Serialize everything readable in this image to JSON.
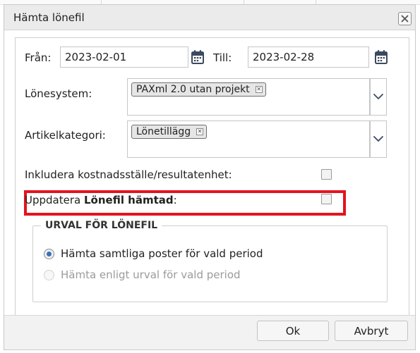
{
  "dialog": {
    "title": "Hämta lönefil",
    "close_icon": "close-icon"
  },
  "dates": {
    "from_label": "Från:",
    "from_value": "2023-02-01",
    "to_label": "Till:",
    "to_value": "2023-02-28",
    "calendar_icon": "calendar-icon"
  },
  "payroll_system": {
    "label": "Lönesystem:",
    "selected_tags": [
      "PAXml 2.0 utan projekt"
    ],
    "dropdown_icon": "chevron-down-icon"
  },
  "article_category": {
    "label": "Artikelkategori:",
    "selected_tags": [
      "Lönetillägg"
    ],
    "dropdown_icon": "chevron-down-icon"
  },
  "options": {
    "include_cost_center_label": "Inkludera kostnadsställe/resultatenhet:",
    "include_cost_center_checked": false,
    "update_prefix": "Uppdatera ",
    "update_bold": "Lönefil hämtad",
    "update_suffix": ":",
    "update_checked": false
  },
  "selection": {
    "legend": "URVAL FÖR LÖNEFIL",
    "option_all": "Hämta samtliga poster för vald period",
    "option_filtered": "Hämta enligt urval för vald period",
    "selected": "option_all"
  },
  "buttons": {
    "ok": "Ok",
    "cancel": "Avbryt"
  },
  "colors": {
    "highlight": "#e3131f",
    "radio_accent": "#3a6fb5",
    "titlebar": "#ebebeb"
  }
}
